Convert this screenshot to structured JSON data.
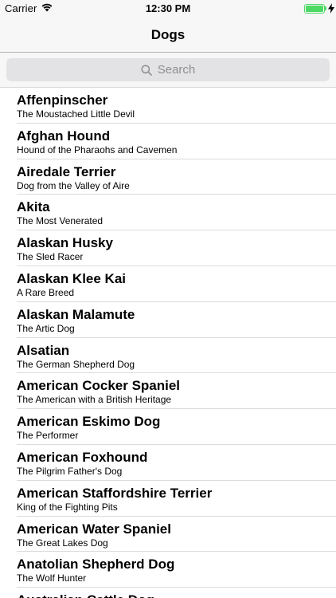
{
  "status_bar": {
    "carrier": "Carrier",
    "time": "12:30 PM",
    "battery_level": 1.0,
    "battery_color": "#4cd964"
  },
  "nav": {
    "title": "Dogs"
  },
  "search": {
    "placeholder": "Search",
    "icon": "magnifier"
  },
  "dogs": [
    {
      "name": "Affenpinscher",
      "subtitle": "The Moustached Little Devil"
    },
    {
      "name": "Afghan Hound",
      "subtitle": "Hound of the Pharaohs and Cavemen"
    },
    {
      "name": "Airedale Terrier",
      "subtitle": "Dog from the Valley of Aire"
    },
    {
      "name": "Akita",
      "subtitle": "The Most Venerated"
    },
    {
      "name": "Alaskan Husky",
      "subtitle": "The Sled Racer"
    },
    {
      "name": "Alaskan Klee Kai",
      "subtitle": "A Rare Breed"
    },
    {
      "name": "Alaskan Malamute",
      "subtitle": "The Artic Dog"
    },
    {
      "name": "Alsatian",
      "subtitle": "The German Shepherd Dog"
    },
    {
      "name": "American Cocker Spaniel",
      "subtitle": "The American with a British Heritage"
    },
    {
      "name": "American Eskimo Dog",
      "subtitle": "The Performer"
    },
    {
      "name": "American Foxhound",
      "subtitle": "The Pilgrim Father's Dog"
    },
    {
      "name": "American Staffordshire Terrier",
      "subtitle": "King of the Fighting Pits"
    },
    {
      "name": "American Water Spaniel",
      "subtitle": "The Great Lakes Dog"
    },
    {
      "name": "Anatolian Shepherd Dog",
      "subtitle": "The Wolf Hunter"
    },
    {
      "name": "Australian Cattle Dog",
      "subtitle": ""
    }
  ]
}
